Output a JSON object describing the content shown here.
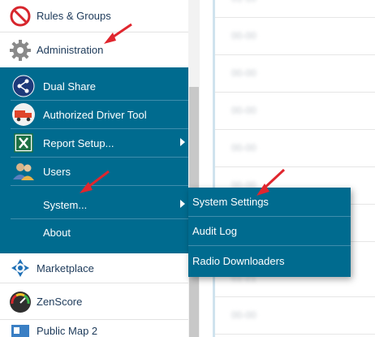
{
  "nav": {
    "rules_groups": {
      "label": "Rules & Groups",
      "icon": "no-entry-icon"
    },
    "administration": {
      "label": "Administration",
      "icon": "gear-icon"
    },
    "marketplace": {
      "label": "Marketplace",
      "icon": "marketplace-icon"
    },
    "zenscore": {
      "label": "ZenScore",
      "icon": "speedometer-icon"
    },
    "public_map": {
      "label": "Public Map 2",
      "icon": "map-icon"
    }
  },
  "admin_submenu": {
    "items": [
      {
        "label": "Dual Share",
        "icon": "share-icon",
        "has_submenu": false
      },
      {
        "label": "Authorized Driver Tool",
        "icon": "truck-icon",
        "has_submenu": false
      },
      {
        "label": "Report Setup...",
        "icon": "excel-icon",
        "has_submenu": true
      },
      {
        "label": "Users",
        "icon": "users-icon",
        "has_submenu": false
      },
      {
        "label": "System...",
        "icon": "",
        "has_submenu": true
      },
      {
        "label": "About",
        "icon": "",
        "has_submenu": false
      }
    ]
  },
  "system_flyout": {
    "items": [
      {
        "label": "System Settings"
      },
      {
        "label": "Audit Log"
      },
      {
        "label": "Radio Downloaders"
      }
    ]
  },
  "content": {
    "rows": [
      "01-10",
      "00-00",
      "00-00",
      "00-00",
      "00-00",
      "00-00",
      "00-00",
      "01-21",
      "00-00"
    ]
  },
  "colors": {
    "menu_bg": "#006b8f",
    "nav_text": "#1d3a5a",
    "annotation_arrow": "#e0262e"
  }
}
